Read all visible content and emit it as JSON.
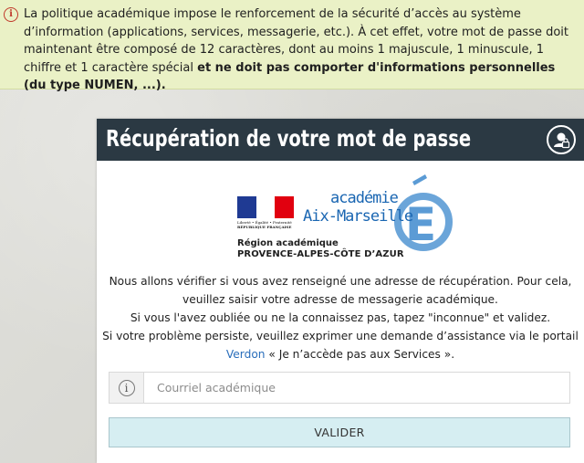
{
  "alert": {
    "text": "La politique académique impose le renforcement de la sécurité d’accès au système d’information (applications, services, messagerie, etc.). À cet effet, votre mot de passe doit maintenant être composé de 12 caractères, dont au moins 1 majuscule, 1 minuscule, 1 chiffre et 1 caractère spécial ",
    "bold_text": "et ne doit pas comporter d'informations personnelles (du type NUMEN, ...).",
    "icon": "info-circle-icon",
    "icon_color": "#c0392b",
    "background": "#eaf1c6"
  },
  "card": {
    "title": "Récupération de votre mot de passe",
    "header_color": "#2b3943",
    "header_icon": "user-lock-icon"
  },
  "logo": {
    "republique": "RÉPUBLIQUE FRANÇAISE",
    "devise": "Liberté • Égalité • Fraternité",
    "academie_word": "académie",
    "academie_name": "Aix-Marseille",
    "accent_color": "#1a66b2",
    "region_line1": "Région académique",
    "region_line2": "PROVENCE-ALPES-CÔTE D’AZUR"
  },
  "info": {
    "line1": "Nous allons vérifier si vous avez renseigné une adresse de récupération. Pour cela,",
    "line2": "veuillez saisir votre adresse de messagerie académique.",
    "line3": "Si vous l'avez oubliée ou ne la connaissez pas, tapez \"inconnue\" et validez.",
    "line4": "Si votre problème persiste, veuillez exprimer une demande d’assistance via le portail",
    "link_text": "Verdon",
    "line5_rest": " « Je n’accède pas aux Services »."
  },
  "form": {
    "input_placeholder": "Courriel académique",
    "input_value": "",
    "input_icon": "info-circle-icon",
    "submit_label": "VALIDER"
  }
}
